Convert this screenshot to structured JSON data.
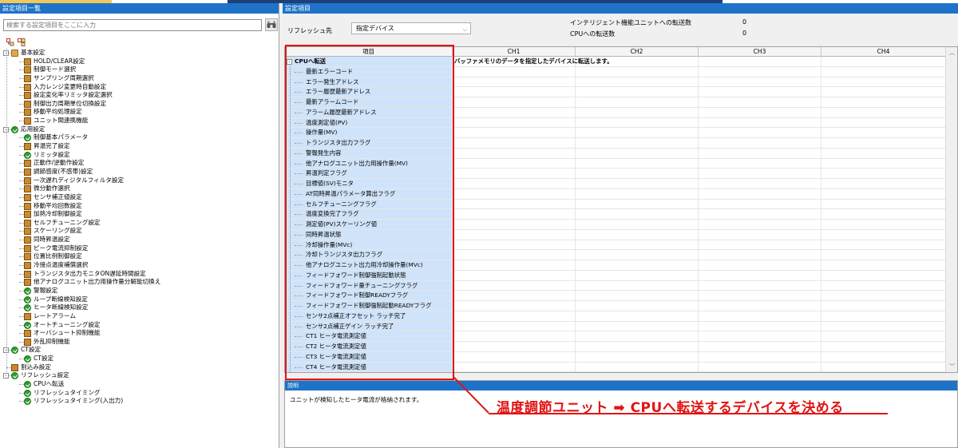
{
  "left_pane": {
    "title": "設定項目一覧",
    "search_placeholder": "検索する設定項目をここに入力",
    "tree": [
      {
        "level": 1,
        "type": "folder",
        "label": "基本設定",
        "expand": "-"
      },
      {
        "level": 2,
        "type": "book",
        "label": "HOLD/CLEAR設定"
      },
      {
        "level": 2,
        "type": "book",
        "label": "制御モード選択"
      },
      {
        "level": 2,
        "type": "book",
        "label": "サンプリング周期選択"
      },
      {
        "level": 2,
        "type": "book",
        "label": "入力レンジ変更時自動設定"
      },
      {
        "level": 2,
        "type": "book",
        "label": "設定変化率リミッタ設定選択"
      },
      {
        "level": 2,
        "type": "book",
        "label": "制御出力周期単位切換設定"
      },
      {
        "level": 2,
        "type": "book",
        "label": "移動平均処理設定"
      },
      {
        "level": 2,
        "type": "book",
        "label": "ユニット間連携機能"
      },
      {
        "level": 1,
        "type": "check",
        "label": "応用設定",
        "expand": "-"
      },
      {
        "level": 2,
        "type": "check",
        "label": "制御基本パラメータ"
      },
      {
        "level": 2,
        "type": "book",
        "label": "昇温完了設定"
      },
      {
        "level": 2,
        "type": "check",
        "label": "リミッタ設定"
      },
      {
        "level": 2,
        "type": "book",
        "label": "正動作/逆動作設定"
      },
      {
        "level": 2,
        "type": "book",
        "label": "調節感度(不感帯)設定"
      },
      {
        "level": 2,
        "type": "book",
        "label": "一次遅れディジタルフィルタ設定"
      },
      {
        "level": 2,
        "type": "book",
        "label": "微分動作選択"
      },
      {
        "level": 2,
        "type": "book",
        "label": "センサ補正値設定"
      },
      {
        "level": 2,
        "type": "book",
        "label": "移動平均回数設定"
      },
      {
        "level": 2,
        "type": "book",
        "label": "加熱冷却制御設定"
      },
      {
        "level": 2,
        "type": "book",
        "label": "セルフチューニング設定"
      },
      {
        "level": 2,
        "type": "book",
        "label": "スケーリング設定"
      },
      {
        "level": 2,
        "type": "book",
        "label": "同時昇温設定"
      },
      {
        "level": 2,
        "type": "book",
        "label": "ピーク電流抑制設定"
      },
      {
        "level": 2,
        "type": "book",
        "label": "位置比例制御設定"
      },
      {
        "level": 2,
        "type": "book",
        "label": "冷接点温度補償選択"
      },
      {
        "level": 2,
        "type": "book",
        "label": "トランジスタ出力モニタON遅延時間設定"
      },
      {
        "level": 2,
        "type": "book",
        "label": "他アナログユニット出力用操作量分解能切換え"
      },
      {
        "level": 2,
        "type": "check",
        "label": "警報設定"
      },
      {
        "level": 2,
        "type": "check",
        "label": "ループ断線検知設定"
      },
      {
        "level": 2,
        "type": "check",
        "label": "ヒータ断線検知設定"
      },
      {
        "level": 2,
        "type": "book",
        "label": "レートアラーム"
      },
      {
        "level": 2,
        "type": "check",
        "label": "オートチューニング設定"
      },
      {
        "level": 2,
        "type": "book",
        "label": "オーバシュート抑制機能"
      },
      {
        "level": 2,
        "type": "book",
        "label": "外乱抑制機能"
      },
      {
        "level": 1,
        "type": "check",
        "label": "CT設定",
        "expand": "-"
      },
      {
        "level": 2,
        "type": "check",
        "label": "CT設定"
      },
      {
        "level": 1,
        "type": "book",
        "label": "割込み設定"
      },
      {
        "level": 1,
        "type": "check",
        "label": "リフレッシュ設定",
        "expand": "-"
      },
      {
        "level": 2,
        "type": "check",
        "label": "CPUへ転送"
      },
      {
        "level": 2,
        "type": "check",
        "label": "リフレッシュタイミング"
      },
      {
        "level": 2,
        "type": "check",
        "label": "リフレッシュタイミング(入出力)"
      }
    ]
  },
  "right_pane": {
    "title": "設定項目",
    "refresh_label": "リフレッシュ先",
    "refresh_value": "指定デバイス",
    "transfer_label_1": "インテリジェント機能ユニットへの転送数",
    "transfer_value_1": "0",
    "transfer_label_2": "CPUへの転送数",
    "transfer_value_2": "0",
    "grid_headers": [
      "項目",
      "CH1",
      "CH2",
      "CH3",
      "CH4"
    ],
    "grid_parent": {
      "label": "CPUへ転送",
      "expand": "-",
      "description": "バッファメモリのデータを指定したデバイスに転送します。"
    },
    "grid_items": [
      "最新エラーコード",
      "エラー発生アドレス",
      "エラー履歴最新アドレス",
      "最新アラームコード",
      "アラーム履歴最新アドレス",
      "温度測定値(PV)",
      "操作量(MV)",
      "トランジスタ出力フラグ",
      "警報発生内容",
      "他アナログユニット出力用操作量(MV)",
      "昇温判定フラグ",
      "目標値(SV)モニタ",
      "AT同時昇温パラメータ算出フラグ",
      "セルフチューニングフラグ",
      "温度変換完了フラグ",
      "測定値(PV)スケーリング値",
      "同時昇温状態",
      "冷却操作量(MVc)",
      "冷却トランジスタ出力フラグ",
      "他アナログユニット出力用冷却操作量(MVc)",
      "フィードフォワード制御強制起動状態",
      "フィードフォワード量チューニングフラグ",
      "フィードフォワード制御READYフラグ",
      "フィードフォワード制御強制起動READYフラグ",
      "センサ2点補正オフセット ラッチ完了",
      "センサ2点補正ゲイン ラッチ完了",
      "CT1 ヒータ電流測定値",
      "CT2 ヒータ電流測定値",
      "CT3 ヒータ電流測定値",
      "CT4 ヒータ電流測定値"
    ],
    "desc_title": "説明",
    "desc_text": "ユニットが検知したヒータ電流が格納されます。"
  },
  "annotation": {
    "text": "温度調節ユニット ➡ CPUへ転送するデバイスを決める",
    "color": "#e01515"
  }
}
